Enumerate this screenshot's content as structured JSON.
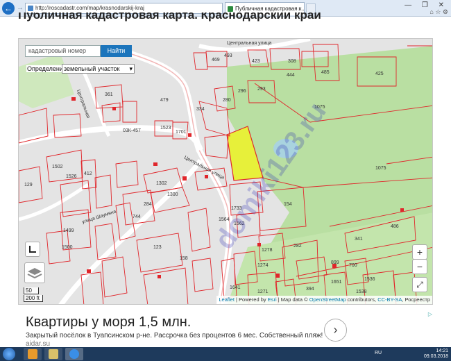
{
  "browser": {
    "url": "http://roscadastr.com/map/krasnodarskij-kraj",
    "tab_title": "Публичная кадастровая к...",
    "tab_close": "×",
    "window_controls": "— ❐ ✕",
    "toolbar_icons": "⌂ ☆ ⚙"
  },
  "page": {
    "title": "Публичная кадастровая карта. Краснодарский край"
  },
  "map": {
    "search_placeholder": "кадастровый номер",
    "search_button": "Найти",
    "definition_label": "Определение",
    "definition_value": "земельный участок",
    "zoom_in": "+",
    "zoom_out": "−",
    "fullscreen": "⤢",
    "scale_m": "50 m",
    "scale_ft": "200 ft",
    "attribution": {
      "leaflet": "Leaflet",
      "powered_by": "Powered by",
      "esri": "Esri",
      "map_data": "Map data ©",
      "osm": "OpenStreetMap",
      "contributors": "contributors,",
      "license": "CC-BY-SA",
      "rosreestr": "Росреестр"
    },
    "watermark": "domiki123.ru",
    "street_labels": [
      "Центральная улица",
      "Центральная улица",
      "улица Шаумяна",
      "Центральная",
      "03К-457"
    ],
    "parcel_labels": [
      "493",
      "469",
      "423",
      "308",
      "444",
      "485",
      "425",
      "361",
      "479",
      "296",
      "293",
      "280",
      "334",
      "1075",
      "1523",
      "1701",
      "1075",
      "129",
      "1502",
      "1526",
      "412",
      "1302",
      "1300",
      "284",
      "744",
      "1733",
      "1564",
      "1562",
      "154",
      "486",
      "341",
      "1278",
      "282",
      "1499",
      "1500",
      "123",
      "158",
      "1274",
      "1271",
      "1641",
      "1651",
      "1536",
      "1538",
      "394",
      "700",
      "899"
    ],
    "colors": {
      "parcel_stroke": "#e0262b",
      "highlight": "#e7f03a",
      "vegetation": "#b8e0a0",
      "road": "#ffffff",
      "water": "#a9d3df"
    }
  },
  "ad": {
    "title": "Квартиры у моря 1,5 млн.",
    "text": "Закрытый посёлок в Туапсинском р-не. Рассрочка без процентов 6 мес. Собственный пляж!",
    "domain": "aidar.su",
    "arrow": "›",
    "marker": "▷"
  },
  "taskbar": {
    "lang": "RU",
    "time": "14:21",
    "date": "09.03.2018"
  }
}
